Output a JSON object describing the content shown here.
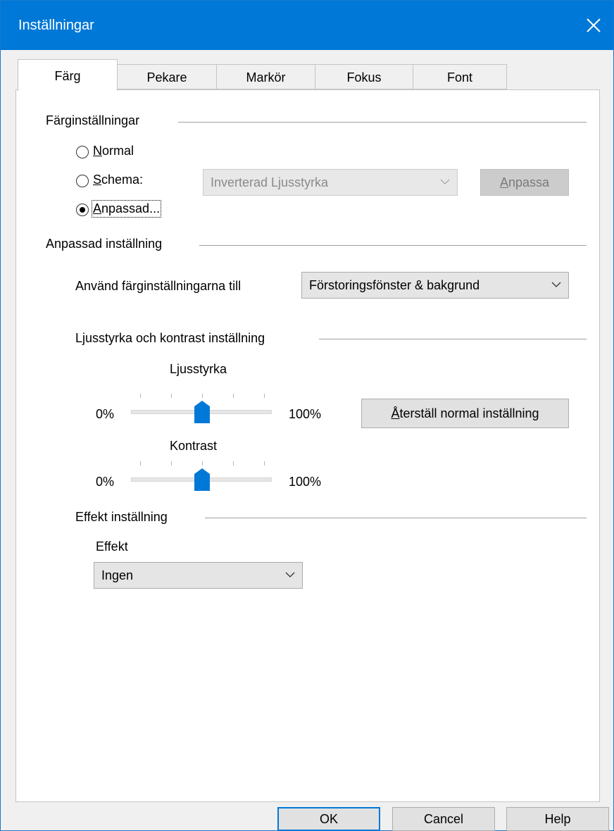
{
  "window": {
    "title": "Inställningar"
  },
  "tabs": [
    {
      "label": "Färg",
      "active": true
    },
    {
      "label": "Pekare",
      "active": false
    },
    {
      "label": "Markör",
      "active": false
    },
    {
      "label": "Fokus",
      "active": false
    },
    {
      "label": "Font",
      "active": false
    }
  ],
  "color_settings": {
    "header": "Färginställningar",
    "radio_normal": {
      "prefix": "N",
      "rest": "ormal",
      "selected": false
    },
    "radio_schema": {
      "prefix": "S",
      "rest": "chema:",
      "selected": false
    },
    "radio_custom": {
      "prefix": "A",
      "rest": "npassad...",
      "selected": true
    },
    "schema_select": {
      "value": "Inverterad Ljusstyrka",
      "disabled": true
    },
    "adjust_button": {
      "prefix": "A",
      "rest": "npassa",
      "disabled": true
    }
  },
  "custom_setting": {
    "header": "Anpassad inställning",
    "apply_label": "Använd färginställningarna till",
    "apply_select": {
      "value": "Förstoringsfönster & bakgrund"
    }
  },
  "brightness_contrast": {
    "header": "Ljusstyrka och kontrast inställning",
    "brightness": {
      "label": "Ljusstyrka",
      "min_label": "0%",
      "max_label": "100%",
      "value_percent": 50
    },
    "reset_button": {
      "prefix": "Å",
      "rest": "terställ normal inställning"
    },
    "contrast": {
      "label": "Kontrast",
      "min_label": "0%",
      "max_label": "100%",
      "value_percent": 50
    }
  },
  "effect": {
    "header": "Effekt inställning",
    "label": "Effekt",
    "select": {
      "value": "Ingen"
    }
  },
  "footer": {
    "ok": "OK",
    "cancel": "Cancel",
    "help": "Help"
  },
  "colors": {
    "accent": "#0078d7",
    "title_text": "#ffffff"
  }
}
